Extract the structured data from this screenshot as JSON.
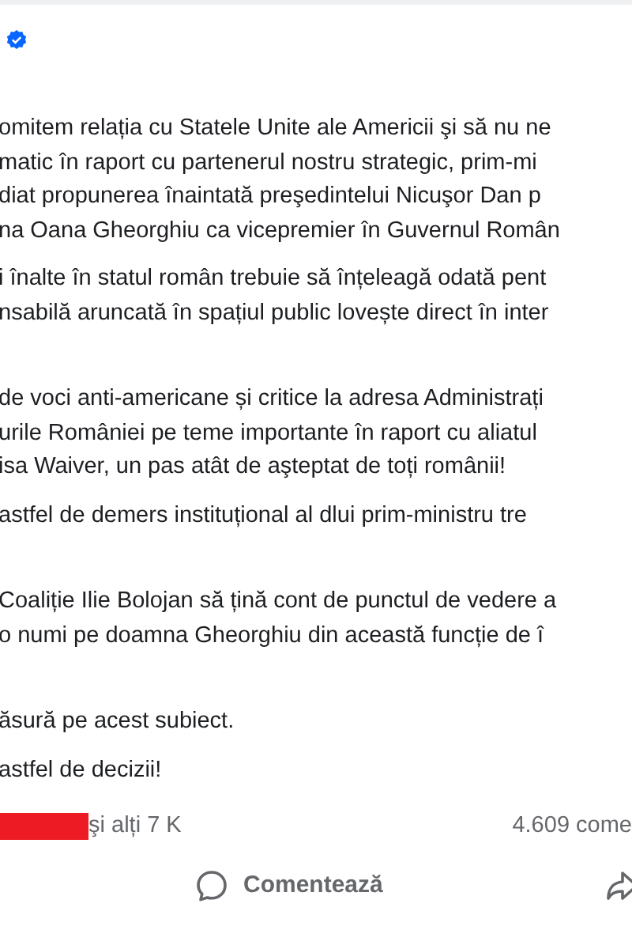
{
  "author": {
    "verified": true
  },
  "sections": [
    {
      "paragraphs": [
        [
          "omitem relația cu Statele Unite ale Americii şi să nu ne",
          "matic în raport cu partenerul nostru strategic, prim-mi",
          "diat propunerea înaintată preşedintelui Nicuşor Dan p",
          "na Oana Gheorghiu ca vicepremier în Guvernul Român"
        ],
        [
          "i înalte în statul român trebuie să înțeleagă odată pent",
          "nsabilă aruncată în spațiul public lovește direct în inter"
        ]
      ]
    },
    {
      "paragraphs": [
        [
          "de voci anti-americane și critice la adresa Administrați",
          "urile României pe teme importante în raport cu aliatul",
          "isa Waiver, un pas atât de aşteptat de toți românii!"
        ],
        [
          "astfel de demers instituțional al dlui prim-ministru tre"
        ]
      ]
    },
    {
      "paragraphs": [
        [
          "Coaliție Ilie Bolojan să țină cont de punctul de vedere a",
          "o numi pe doamna Gheorghiu din această funcție de î"
        ]
      ]
    },
    {
      "paragraphs": [
        [
          "ăsură pe acest subiect."
        ],
        [
          "astfel de decizii!"
        ]
      ]
    }
  ],
  "reactions": {
    "others": "şi alți 7 K",
    "comments": "4.609 come"
  },
  "actions": [
    {
      "kind": "comment",
      "label": "Comentează"
    },
    {
      "kind": "share"
    }
  ]
}
